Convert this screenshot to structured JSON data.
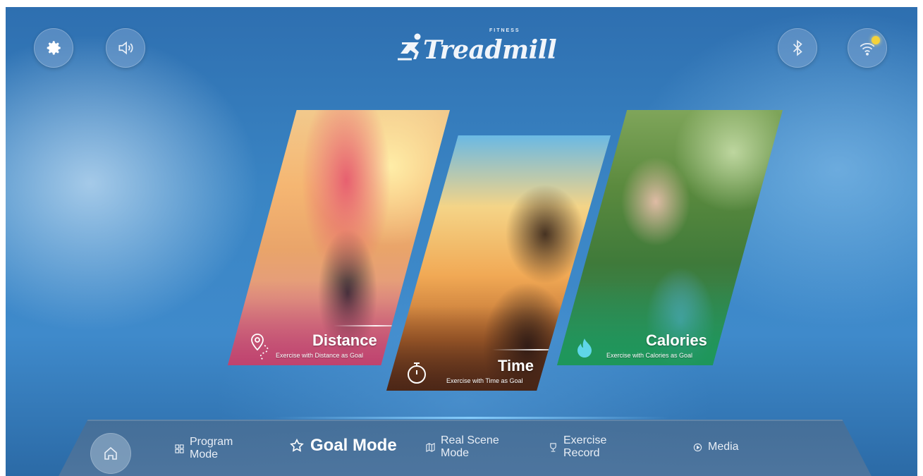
{
  "header": {
    "brand": "Treadmill",
    "brand_tagline": "FITNESS",
    "left_buttons": [
      {
        "name": "settings",
        "icon": "gear-icon"
      },
      {
        "name": "sound",
        "icon": "speaker-icon"
      }
    ],
    "right_buttons": [
      {
        "name": "bluetooth",
        "icon": "bluetooth-icon"
      },
      {
        "name": "wifi",
        "icon": "wifi-icon",
        "status_color": "#f3d23a"
      }
    ]
  },
  "cards": {
    "distance": {
      "title": "Distance",
      "subtitle": "Exercise with Distance as Goal",
      "icon": "location-pin-icon"
    },
    "time": {
      "title": "Time",
      "subtitle": "Exercise with Time as Goal",
      "icon": "stopwatch-icon"
    },
    "calories": {
      "title": "Calories",
      "subtitle": "Exercise with Calories as Goal",
      "icon": "flame-icon"
    }
  },
  "nav": {
    "home_icon": "home-icon",
    "items": [
      {
        "line1": "Program",
        "line2": "Mode",
        "icon": "grid-icon"
      },
      {
        "label": "Goal Mode",
        "icon": "star-icon",
        "active": true
      },
      {
        "line1": "Real Scene",
        "line2": "Mode",
        "icon": "map-icon"
      },
      {
        "line1": "Exercise",
        "line2": "Record",
        "icon": "trophy-icon"
      },
      {
        "label": "Media",
        "icon": "play-circle-icon"
      }
    ]
  },
  "colors": {
    "background": "#3a85c4",
    "active_nav_text": "#ffffff",
    "wifi_indicator": "#f3d23a"
  }
}
